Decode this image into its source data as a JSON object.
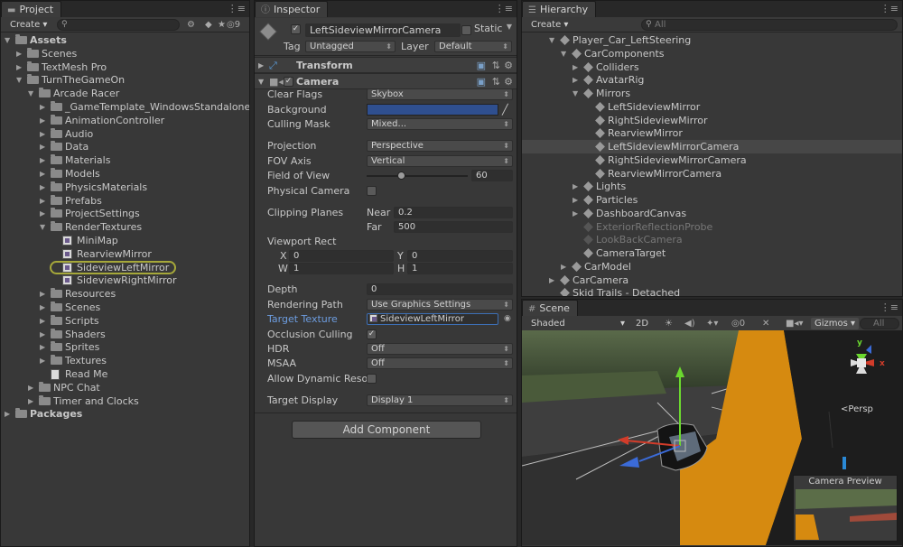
{
  "project": {
    "tab": "Project",
    "create": "Create",
    "badge": "9",
    "tree": [
      {
        "label": "Assets",
        "bold": true,
        "arrow": "▼",
        "icon": "folder"
      },
      {
        "label": "Scenes",
        "arrow": "▶",
        "icon": "folder"
      },
      {
        "label": "TextMesh Pro",
        "arrow": "▶",
        "icon": "folder"
      },
      {
        "label": "TurnTheGameOn",
        "arrow": "▼",
        "icon": "folder"
      },
      {
        "label": "Arcade Racer",
        "arrow": "▼",
        "icon": "folder"
      },
      {
        "label": "_GameTemplate_WindowsStandalone",
        "arrow": "▶",
        "icon": "folder"
      },
      {
        "label": "AnimationController",
        "arrow": "▶",
        "icon": "folder"
      },
      {
        "label": "Audio",
        "arrow": "▶",
        "icon": "folder"
      },
      {
        "label": "Data",
        "arrow": "▶",
        "icon": "folder"
      },
      {
        "label": "Materials",
        "arrow": "▶",
        "icon": "folder"
      },
      {
        "label": "Models",
        "arrow": "▶",
        "icon": "folder"
      },
      {
        "label": "PhysicsMaterials",
        "arrow": "▶",
        "icon": "folder"
      },
      {
        "label": "Prefabs",
        "arrow": "▶",
        "icon": "folder"
      },
      {
        "label": "ProjectSettings",
        "arrow": "▶",
        "icon": "folder"
      },
      {
        "label": "RenderTextures",
        "arrow": "▼",
        "icon": "folder"
      },
      {
        "label": "MiniMap",
        "arrow": "",
        "icon": "rtex"
      },
      {
        "label": "RearviewMirror",
        "arrow": "",
        "icon": "rtex"
      },
      {
        "label": "SideviewLeftMirror",
        "arrow": "",
        "icon": "rtex"
      },
      {
        "label": "SideviewRightMirror",
        "arrow": "",
        "icon": "rtex"
      },
      {
        "label": "Resources",
        "arrow": "▶",
        "icon": "folder"
      },
      {
        "label": "Scenes",
        "arrow": "▶",
        "icon": "folder"
      },
      {
        "label": "Scripts",
        "arrow": "▶",
        "icon": "folder"
      },
      {
        "label": "Shaders",
        "arrow": "▶",
        "icon": "folder"
      },
      {
        "label": "Sprites",
        "arrow": "▶",
        "icon": "folder"
      },
      {
        "label": "Textures",
        "arrow": "▶",
        "icon": "folder"
      },
      {
        "label": "Read Me",
        "arrow": "",
        "icon": "doc"
      },
      {
        "label": "NPC Chat",
        "arrow": "▶",
        "icon": "folder"
      },
      {
        "label": "Timer and Clocks",
        "arrow": "▶",
        "icon": "folder"
      },
      {
        "label": "Packages",
        "bold": true,
        "arrow": "▶",
        "icon": "folder"
      }
    ]
  },
  "inspector": {
    "tab": "Inspector",
    "object_name": "LeftSideviewMirrorCamera",
    "static_label": "Static",
    "tag_label": "Tag",
    "tag_value": "Untagged",
    "layer_label": "Layer",
    "layer_value": "Default",
    "transform_title": "Transform",
    "camera_title": "Camera",
    "fields": {
      "clear_flags": {
        "label": "Clear Flags",
        "value": "Skybox"
      },
      "background": {
        "label": "Background",
        "color": "#2f4f8f"
      },
      "culling_mask": {
        "label": "Culling Mask",
        "value": "Mixed..."
      },
      "projection": {
        "label": "Projection",
        "value": "Perspective"
      },
      "fov_axis": {
        "label": "FOV Axis",
        "value": "Vertical"
      },
      "field_of_view": {
        "label": "Field of View",
        "value": "60",
        "slider_fraction": 0.34
      },
      "physical_camera": {
        "label": "Physical Camera"
      },
      "clipping_planes": {
        "label": "Clipping Planes",
        "near_label": "Near",
        "near": "0.2",
        "far_label": "Far",
        "far": "500"
      },
      "viewport_rect": {
        "label": "Viewport Rect",
        "x_label": "X",
        "x": "0",
        "y_label": "Y",
        "y": "0",
        "w_label": "W",
        "w": "1",
        "h_label": "H",
        "h": "1"
      },
      "depth": {
        "label": "Depth",
        "value": "0"
      },
      "rendering_path": {
        "label": "Rendering Path",
        "value": "Use Graphics Settings"
      },
      "target_texture": {
        "label": "Target Texture",
        "value": "SideviewLeftMirror"
      },
      "occlusion_culling": {
        "label": "Occlusion Culling"
      },
      "hdr": {
        "label": "HDR",
        "value": "Off"
      },
      "msaa": {
        "label": "MSAA",
        "value": "Off"
      },
      "allow_dynamic": {
        "label": "Allow Dynamic Resol"
      },
      "target_display": {
        "label": "Target Display",
        "value": "Display 1"
      }
    },
    "add_component": "Add Component"
  },
  "hierarchy": {
    "tab": "Hierarchy",
    "create": "Create",
    "search_placeholder": "All",
    "items": [
      {
        "label": "Player_Car_LeftSteering",
        "indent": 0,
        "arrow": "▼"
      },
      {
        "label": "CarComponents",
        "indent": 1,
        "arrow": "▼"
      },
      {
        "label": "Colliders",
        "indent": 2,
        "arrow": "▶"
      },
      {
        "label": "AvatarRig",
        "indent": 2,
        "arrow": "▶"
      },
      {
        "label": "Mirrors",
        "indent": 2,
        "arrow": "▼"
      },
      {
        "label": "LeftSideviewMirror",
        "indent": 3,
        "arrow": ""
      },
      {
        "label": "RightSideviewMirror",
        "indent": 3,
        "arrow": ""
      },
      {
        "label": "RearviewMirror",
        "indent": 3,
        "arrow": ""
      },
      {
        "label": "LeftSideviewMirrorCamera",
        "indent": 3,
        "arrow": "",
        "selected": true
      },
      {
        "label": "RightSideviewMirrorCamera",
        "indent": 3,
        "arrow": ""
      },
      {
        "label": "RearviewMirrorCamera",
        "indent": 3,
        "arrow": ""
      },
      {
        "label": "Lights",
        "indent": 2,
        "arrow": "▶"
      },
      {
        "label": "Particles",
        "indent": 2,
        "arrow": "▶"
      },
      {
        "label": "DashboardCanvas",
        "indent": 2,
        "arrow": "▶"
      },
      {
        "label": "ExteriorReflectionProbe",
        "indent": 2,
        "arrow": "",
        "dim": true
      },
      {
        "label": "LookBackCamera",
        "indent": 2,
        "arrow": "",
        "dim": true
      },
      {
        "label": "CameraTarget",
        "indent": 2,
        "arrow": ""
      },
      {
        "label": "CarModel",
        "indent": 1,
        "arrow": "▶"
      },
      {
        "label": "CarCamera",
        "indent": 0,
        "arrow": "▶"
      },
      {
        "label": "Skid Trails - Detached",
        "indent": 0,
        "arrow": ""
      }
    ]
  },
  "scene": {
    "tab": "Scene",
    "shading": "Shaded",
    "mode_2d": "2D",
    "gizmos": "Gizmos",
    "search_placeholder": "All",
    "persp_label": "Persp",
    "gizmo_y": "y",
    "gizmo_x": "x",
    "camera_preview": "Camera Preview"
  }
}
